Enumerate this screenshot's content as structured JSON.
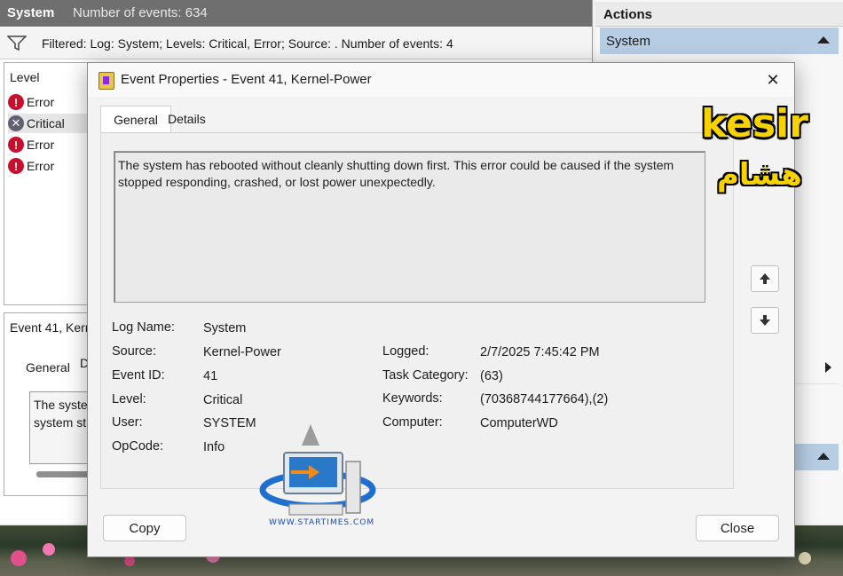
{
  "main": {
    "title": "System",
    "event_count": "Number of events: 634",
    "filter_text": "Filtered: Log: System; Levels: Critical, Error; Source: . Number of events: 4",
    "list_header": "Level",
    "list_items": [
      {
        "icon": "error-icon",
        "label": "Error"
      },
      {
        "icon": "critical-icon",
        "label": "Critical"
      },
      {
        "icon": "error-icon",
        "label": "Error"
      },
      {
        "icon": "error-icon",
        "label": "Error"
      }
    ],
    "detail": {
      "title": "Event 41, Kerr",
      "tab_general": "General",
      "tab_details": "D",
      "preview_line1": "The syste",
      "preview_line2": "system st"
    }
  },
  "actions": {
    "header": "Actions",
    "section": "System"
  },
  "dialog": {
    "title": "Event Properties - Event 41, Kernel-Power",
    "tabs": [
      "General",
      "Details"
    ],
    "description": "The system has rebooted without cleanly shutting down first. This error could be caused if the system stopped responding, crashed, or lost power unexpectedly.",
    "fields": {
      "log_name_label": "Log Name:",
      "log_name": "System",
      "source_label": "Source:",
      "source": "Kernel-Power",
      "event_id_label": "Event ID:",
      "event_id": "41",
      "level_label": "Level:",
      "level": "Critical",
      "user_label": "User:",
      "user": "SYSTEM",
      "opcode_label": "OpCode:",
      "opcode": "Info",
      "logged_label": "Logged:",
      "logged": "2/7/2025 7:45:42 PM",
      "task_category_label": "Task Category:",
      "task_category": "(63)",
      "keywords_label": "Keywords:",
      "keywords": "(70368744177664),(2)",
      "computer_label": "Computer:",
      "computer": "ComputerWD"
    },
    "copy_button": "Copy",
    "close_button": "Close"
  },
  "watermark": {
    "name": "kesir",
    "arabic": "هشام",
    "logo_text": "WWW.STARTIMES.COM"
  }
}
